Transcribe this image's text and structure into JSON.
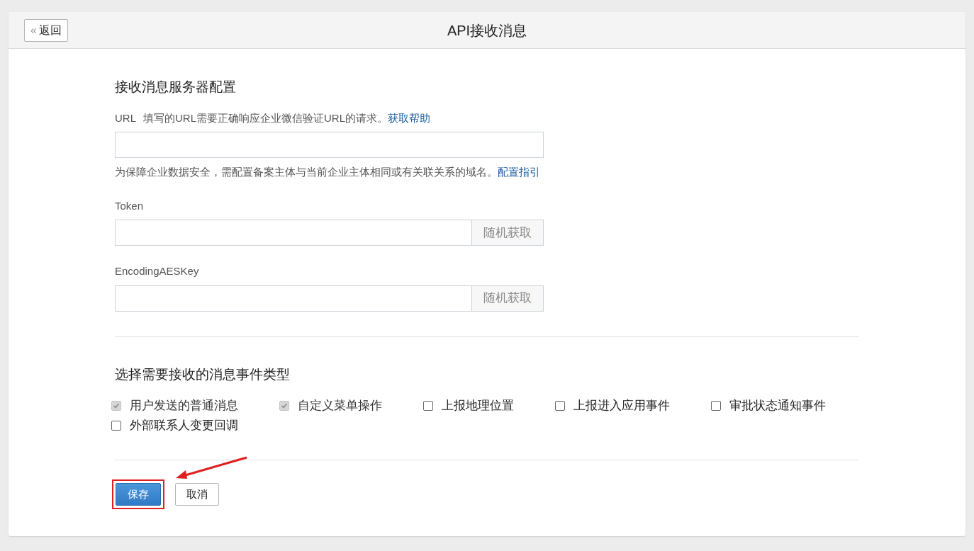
{
  "header": {
    "back_button": {
      "icon": "«",
      "label": "返回"
    },
    "title": "API接收消息"
  },
  "server_config": {
    "heading": "接收消息服务器配置",
    "url": {
      "label": "URL",
      "hint": "填写的URL需要正确响应企业微信验证URL的请求。",
      "help_link": "获取帮助",
      "note": "为保障企业数据安全，需配置备案主体与当前企业主体相同或有关联关系的域名。",
      "note_link": "配置指引"
    },
    "token": {
      "label": "Token",
      "button": "随机获取"
    },
    "aes_key": {
      "label": "EncodingAESKey",
      "button": "随机获取"
    }
  },
  "events": {
    "heading": "选择需要接收的消息事件类型",
    "options": [
      {
        "label": "用户发送的普通消息",
        "checked": true,
        "disabled": true
      },
      {
        "label": "自定义菜单操作",
        "checked": true,
        "disabled": true
      },
      {
        "label": "上报地理位置",
        "checked": false,
        "disabled": false
      },
      {
        "label": "上报进入应用事件",
        "checked": false,
        "disabled": false
      },
      {
        "label": "审批状态通知事件",
        "checked": false,
        "disabled": false
      },
      {
        "label": "外部联系人变更回调",
        "checked": false,
        "disabled": false
      }
    ]
  },
  "actions": [
    {
      "label": "保存",
      "kind": "primary",
      "highlighted": true
    },
    {
      "label": "取消",
      "kind": "default",
      "highlighted": false
    }
  ]
}
